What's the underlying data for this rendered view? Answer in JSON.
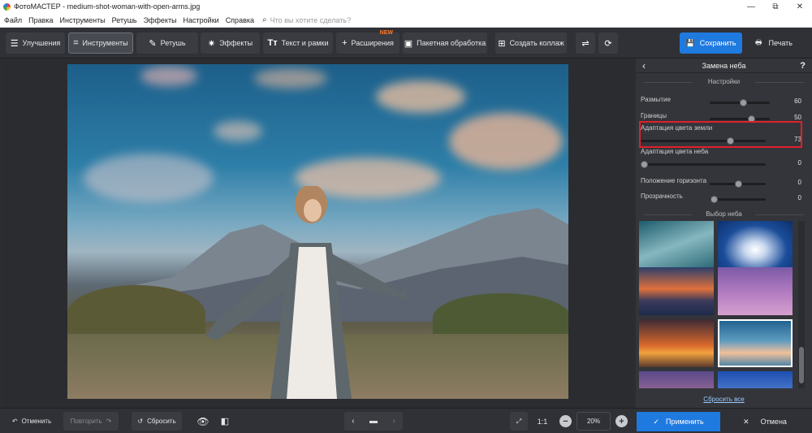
{
  "window": {
    "title": "ФотоМАСТЕР - medium-shot-woman-with-open-arms.jpg",
    "minimize": "—",
    "maximize": "⧉",
    "close": "✕"
  },
  "menu": {
    "items": [
      "Файл",
      "Правка",
      "Инструменты",
      "Ретушь",
      "Эффекты",
      "Настройки",
      "Справка"
    ],
    "search_placeholder": "Что вы хотите сделать?"
  },
  "toolbar": {
    "tabs": [
      {
        "label": "Улучшения",
        "icon": "sliders-icon"
      },
      {
        "label": "Инструменты",
        "icon": "crop-icon",
        "active": true
      },
      {
        "label": "Ретушь",
        "icon": "brush-icon"
      },
      {
        "label": "Эффекты",
        "icon": "sparkle-icon"
      },
      {
        "label": "Текст и рамки",
        "icon": "text-icon"
      },
      {
        "label": "Расширения",
        "icon": "plus-icon",
        "badge": "NEW"
      },
      {
        "label": "Пакетная обработка",
        "icon": "image-icon"
      },
      {
        "label": "Создать коллаж",
        "icon": "collage-icon"
      }
    ],
    "save_label": "Сохранить",
    "print_label": "Печать"
  },
  "panel": {
    "title": "Замена неба",
    "help": "?",
    "settings_title": "Настройки",
    "sliders": [
      {
        "label": "Размытие",
        "value": "60"
      },
      {
        "label": "Границы",
        "value": "50"
      },
      {
        "label": "Адаптация цвета земли",
        "value": "73"
      },
      {
        "label": "Адаптация цвета неба",
        "value": "0"
      },
      {
        "label": "Положение горизонта",
        "value": "0"
      },
      {
        "label": "Прозрачность",
        "value": "0"
      }
    ],
    "sky_title": "Выбор неба",
    "reset_all": "Сбросить все"
  },
  "bottom": {
    "undo": "Отменить",
    "redo": "Повторить",
    "reset": "Сбросить",
    "ratio": "1:1",
    "zoom": "20%",
    "apply": "Применить",
    "cancel": "Отмена"
  },
  "colors": {
    "accent": "#1f7ae0",
    "highlight": "#e0202a",
    "panel": "#33353a",
    "background": "#2b2d31"
  }
}
